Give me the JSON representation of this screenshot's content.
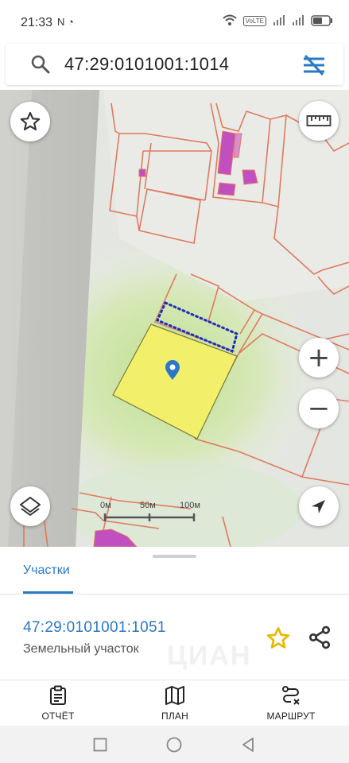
{
  "status_bar": {
    "time": "21:33",
    "left_icons": "N ◔",
    "network_badge": "VoLTE",
    "icons": [
      "wifi-icon",
      "signal-icon",
      "signal-icon",
      "battery-icon"
    ]
  },
  "search": {
    "query": "47:29:0101001:1014",
    "icon": "search-icon",
    "filter_icon": "filter-off-icon"
  },
  "map": {
    "scale_labels": [
      "0м",
      "50м",
      "100м"
    ],
    "buttons": {
      "favorite": "star-outline-icon",
      "ruler": "ruler-icon",
      "zoom_in": "+",
      "zoom_out": "−",
      "layers": "layers-icon",
      "locate": "navigation-arrow-icon"
    },
    "colors": {
      "parcel_border": "#e07a5f",
      "selected_parcel_fill": "#f2ef6b",
      "building_fill": "#c24fc0",
      "dotted_boundary": "#1f2fb5",
      "marker": "#2b79c6"
    }
  },
  "sheet": {
    "tab": "Участки",
    "parcel_number": "47:29:0101001:1051",
    "parcel_type": "Земельный участок",
    "watermark": "ЦИАН"
  },
  "bottom_nav": [
    {
      "label": "ОТЧЁТ",
      "icon": "clipboard-icon"
    },
    {
      "label": "ПЛАН",
      "icon": "map-icon"
    },
    {
      "label": "МАРШРУТ",
      "icon": "route-icon"
    }
  ],
  "colors": {
    "accent": "#2b79c6",
    "star": "#f2c200"
  }
}
